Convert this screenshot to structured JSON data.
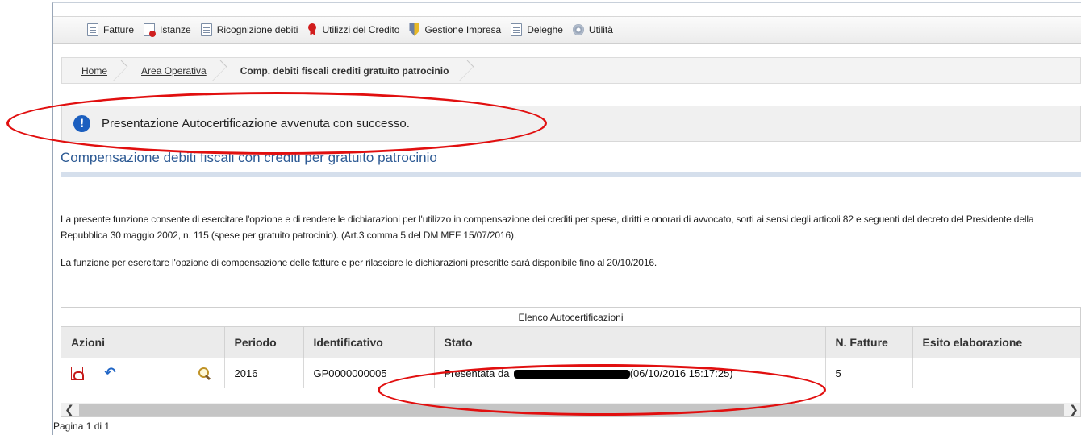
{
  "menu": {
    "items": [
      {
        "label": "Fatture",
        "icon": "document-icon"
      },
      {
        "label": "Istanze",
        "icon": "document-red-icon"
      },
      {
        "label": "Ricognizione debiti",
        "icon": "document-icon"
      },
      {
        "label": "Utilizzi del Credito",
        "icon": "ribbon-icon"
      },
      {
        "label": "Gestione Impresa",
        "icon": "shield-icon"
      },
      {
        "label": "Deleghe",
        "icon": "document-icon"
      },
      {
        "label": "Utilità",
        "icon": "gear-icon"
      }
    ]
  },
  "breadcrumb": {
    "home": "Home",
    "area": "Area Operativa",
    "current": "Comp. debiti fiscali crediti gratuito patrocinio"
  },
  "message": {
    "text": "Presentazione Autocertificazione avvenuta con successo.",
    "icon": "info-icon"
  },
  "page": {
    "title": "Compensazione debiti fiscali con crediti per gratuito patrocinio",
    "description_1": "La presente funzione consente di esercitare l'opzione e di rendere le dichiarazioni per l'utilizzo in compensazione dei crediti per spese, diritti e onorari di avvocato, sorti ai sensi degli articoli 82 e seguenti del decreto del Presidente della Repubblica 30 maggio 2002, n. 115 (spese per gratuito patrocinio). (Art.3 comma 5 del DM MEF 15/07/2016).",
    "description_2": "La funzione per esercitare l'opzione di compensazione delle fatture e per rilasciare le dichiarazioni prescritte sarà disponibile fino al 20/10/2016."
  },
  "table": {
    "caption": "Elenco Autocertificazioni",
    "headers": {
      "azioni": "Azioni",
      "periodo": "Periodo",
      "identificativo": "Identificativo",
      "stato": "Stato",
      "n_fatture": "N. Fatture",
      "esito": "Esito elaborazione"
    },
    "rows": [
      {
        "periodo": "2016",
        "identificativo": "GP0000000005",
        "stato_prefix": "Presentata da",
        "stato_suffix": "(06/10/2016 15:17:25)",
        "n_fatture": "5",
        "esito": ""
      }
    ]
  },
  "pager": {
    "text": "Pagina 1 di 1"
  },
  "colors": {
    "title": "#2d5a94",
    "annotation": "#e10f0f",
    "info": "#1c5fbf"
  }
}
